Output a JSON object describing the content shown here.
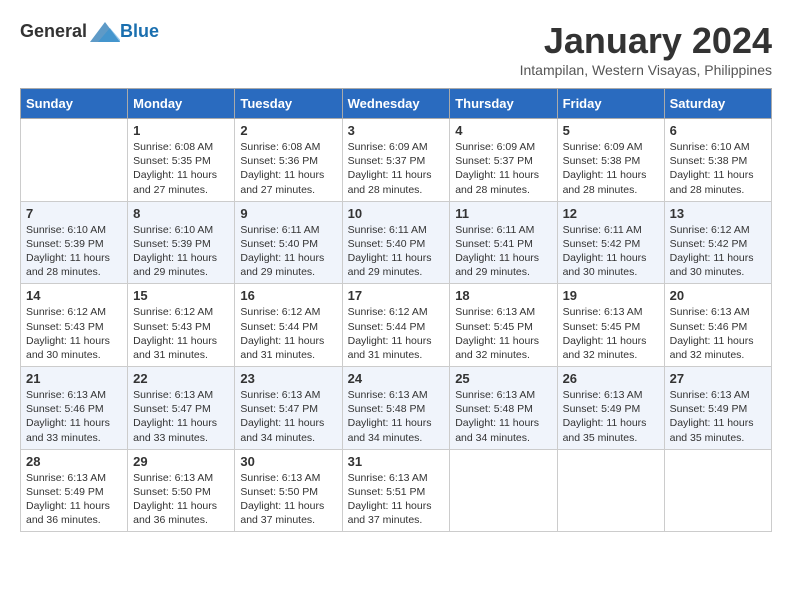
{
  "header": {
    "logo_general": "General",
    "logo_blue": "Blue",
    "month_title": "January 2024",
    "location": "Intampilan, Western Visayas, Philippines"
  },
  "days_of_week": [
    "Sunday",
    "Monday",
    "Tuesday",
    "Wednesday",
    "Thursday",
    "Friday",
    "Saturday"
  ],
  "weeks": [
    [
      {
        "day": "",
        "sunrise": "",
        "sunset": "",
        "daylight": ""
      },
      {
        "day": "1",
        "sunrise": "Sunrise: 6:08 AM",
        "sunset": "Sunset: 5:35 PM",
        "daylight": "Daylight: 11 hours and 27 minutes."
      },
      {
        "day": "2",
        "sunrise": "Sunrise: 6:08 AM",
        "sunset": "Sunset: 5:36 PM",
        "daylight": "Daylight: 11 hours and 27 minutes."
      },
      {
        "day": "3",
        "sunrise": "Sunrise: 6:09 AM",
        "sunset": "Sunset: 5:37 PM",
        "daylight": "Daylight: 11 hours and 28 minutes."
      },
      {
        "day": "4",
        "sunrise": "Sunrise: 6:09 AM",
        "sunset": "Sunset: 5:37 PM",
        "daylight": "Daylight: 11 hours and 28 minutes."
      },
      {
        "day": "5",
        "sunrise": "Sunrise: 6:09 AM",
        "sunset": "Sunset: 5:38 PM",
        "daylight": "Daylight: 11 hours and 28 minutes."
      },
      {
        "day": "6",
        "sunrise": "Sunrise: 6:10 AM",
        "sunset": "Sunset: 5:38 PM",
        "daylight": "Daylight: 11 hours and 28 minutes."
      }
    ],
    [
      {
        "day": "7",
        "sunrise": "Sunrise: 6:10 AM",
        "sunset": "Sunset: 5:39 PM",
        "daylight": "Daylight: 11 hours and 28 minutes."
      },
      {
        "day": "8",
        "sunrise": "Sunrise: 6:10 AM",
        "sunset": "Sunset: 5:39 PM",
        "daylight": "Daylight: 11 hours and 29 minutes."
      },
      {
        "day": "9",
        "sunrise": "Sunrise: 6:11 AM",
        "sunset": "Sunset: 5:40 PM",
        "daylight": "Daylight: 11 hours and 29 minutes."
      },
      {
        "day": "10",
        "sunrise": "Sunrise: 6:11 AM",
        "sunset": "Sunset: 5:40 PM",
        "daylight": "Daylight: 11 hours and 29 minutes."
      },
      {
        "day": "11",
        "sunrise": "Sunrise: 6:11 AM",
        "sunset": "Sunset: 5:41 PM",
        "daylight": "Daylight: 11 hours and 29 minutes."
      },
      {
        "day": "12",
        "sunrise": "Sunrise: 6:11 AM",
        "sunset": "Sunset: 5:42 PM",
        "daylight": "Daylight: 11 hours and 30 minutes."
      },
      {
        "day": "13",
        "sunrise": "Sunrise: 6:12 AM",
        "sunset": "Sunset: 5:42 PM",
        "daylight": "Daylight: 11 hours and 30 minutes."
      }
    ],
    [
      {
        "day": "14",
        "sunrise": "Sunrise: 6:12 AM",
        "sunset": "Sunset: 5:43 PM",
        "daylight": "Daylight: 11 hours and 30 minutes."
      },
      {
        "day": "15",
        "sunrise": "Sunrise: 6:12 AM",
        "sunset": "Sunset: 5:43 PM",
        "daylight": "Daylight: 11 hours and 31 minutes."
      },
      {
        "day": "16",
        "sunrise": "Sunrise: 6:12 AM",
        "sunset": "Sunset: 5:44 PM",
        "daylight": "Daylight: 11 hours and 31 minutes."
      },
      {
        "day": "17",
        "sunrise": "Sunrise: 6:12 AM",
        "sunset": "Sunset: 5:44 PM",
        "daylight": "Daylight: 11 hours and 31 minutes."
      },
      {
        "day": "18",
        "sunrise": "Sunrise: 6:13 AM",
        "sunset": "Sunset: 5:45 PM",
        "daylight": "Daylight: 11 hours and 32 minutes."
      },
      {
        "day": "19",
        "sunrise": "Sunrise: 6:13 AM",
        "sunset": "Sunset: 5:45 PM",
        "daylight": "Daylight: 11 hours and 32 minutes."
      },
      {
        "day": "20",
        "sunrise": "Sunrise: 6:13 AM",
        "sunset": "Sunset: 5:46 PM",
        "daylight": "Daylight: 11 hours and 32 minutes."
      }
    ],
    [
      {
        "day": "21",
        "sunrise": "Sunrise: 6:13 AM",
        "sunset": "Sunset: 5:46 PM",
        "daylight": "Daylight: 11 hours and 33 minutes."
      },
      {
        "day": "22",
        "sunrise": "Sunrise: 6:13 AM",
        "sunset": "Sunset: 5:47 PM",
        "daylight": "Daylight: 11 hours and 33 minutes."
      },
      {
        "day": "23",
        "sunrise": "Sunrise: 6:13 AM",
        "sunset": "Sunset: 5:47 PM",
        "daylight": "Daylight: 11 hours and 34 minutes."
      },
      {
        "day": "24",
        "sunrise": "Sunrise: 6:13 AM",
        "sunset": "Sunset: 5:48 PM",
        "daylight": "Daylight: 11 hours and 34 minutes."
      },
      {
        "day": "25",
        "sunrise": "Sunrise: 6:13 AM",
        "sunset": "Sunset: 5:48 PM",
        "daylight": "Daylight: 11 hours and 34 minutes."
      },
      {
        "day": "26",
        "sunrise": "Sunrise: 6:13 AM",
        "sunset": "Sunset: 5:49 PM",
        "daylight": "Daylight: 11 hours and 35 minutes."
      },
      {
        "day": "27",
        "sunrise": "Sunrise: 6:13 AM",
        "sunset": "Sunset: 5:49 PM",
        "daylight": "Daylight: 11 hours and 35 minutes."
      }
    ],
    [
      {
        "day": "28",
        "sunrise": "Sunrise: 6:13 AM",
        "sunset": "Sunset: 5:49 PM",
        "daylight": "Daylight: 11 hours and 36 minutes."
      },
      {
        "day": "29",
        "sunrise": "Sunrise: 6:13 AM",
        "sunset": "Sunset: 5:50 PM",
        "daylight": "Daylight: 11 hours and 36 minutes."
      },
      {
        "day": "30",
        "sunrise": "Sunrise: 6:13 AM",
        "sunset": "Sunset: 5:50 PM",
        "daylight": "Daylight: 11 hours and 37 minutes."
      },
      {
        "day": "31",
        "sunrise": "Sunrise: 6:13 AM",
        "sunset": "Sunset: 5:51 PM",
        "daylight": "Daylight: 11 hours and 37 minutes."
      },
      {
        "day": "",
        "sunrise": "",
        "sunset": "",
        "daylight": ""
      },
      {
        "day": "",
        "sunrise": "",
        "sunset": "",
        "daylight": ""
      },
      {
        "day": "",
        "sunrise": "",
        "sunset": "",
        "daylight": ""
      }
    ]
  ]
}
